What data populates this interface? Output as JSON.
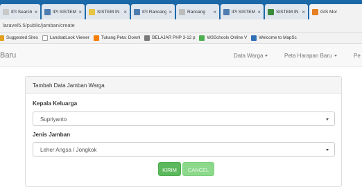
{
  "browser": {
    "tabs": [
      {
        "label": "IPI Search",
        "icon": "ipi-favicon",
        "color": "#c9c9c9"
      },
      {
        "label": "IPI SISTEM",
        "icon": "ipi-favicon",
        "color": "#4f7db0"
      },
      {
        "label": "SISTEM IN",
        "icon": "sistem-favicon",
        "color": "#e8c540"
      },
      {
        "label": "IPI Rancang",
        "icon": "ipi-favicon",
        "color": "#4f7db0"
      },
      {
        "label": "Rancang",
        "icon": "pdf-favicon",
        "color": "#bdbdbd"
      },
      {
        "label": "IPI SISTEM",
        "icon": "ipi-favicon",
        "color": "#4f7db0"
      },
      {
        "label": "SISTEM IN",
        "icon": "sistem-favicon",
        "color": "#3a8a3a"
      },
      {
        "label": "GIS Mor",
        "icon": "gis-favicon",
        "color": "#e67e22"
      }
    ],
    "url": "laravel5.5/public/jamban/create",
    "bookmarks": [
      {
        "label": "Suggested Sites",
        "icon": "apps-icon",
        "color": "#e0a020"
      },
      {
        "label": "LandsatLook Viewer",
        "icon": "page-icon",
        "color": "#9e9e9e"
      },
      {
        "label": "Tukang Peta: Downl",
        "icon": "blogger-icon",
        "color": "#f57d00"
      },
      {
        "label": "BELAJAR PHP 3-12 p",
        "icon": "php-icon",
        "color": "#7a7a7a"
      },
      {
        "label": "W3Schools Online V",
        "icon": "w3schools-icon",
        "color": "#4caf50"
      },
      {
        "label": "Welcome to MapSc",
        "icon": "mapsc-icon",
        "color": "#2e6fb5"
      }
    ]
  },
  "navbar": {
    "brand": "Baru",
    "links": [
      {
        "label": "Data Warga",
        "dropdown": true
      },
      {
        "label": "Peta Harapan Baru",
        "dropdown": true
      },
      {
        "label": "Pe",
        "dropdown": false
      }
    ]
  },
  "form": {
    "heading": "Tambah Data Jamban Warga",
    "kepala_label": "Kepala Keluarga",
    "kepala_value": "Supriyanto",
    "jenis_label": "Jenis Jamban",
    "jenis_value": "Leher Angsa / Jongkok",
    "submit_label": "KIRIM",
    "cancel_label": "CANCEL",
    "colors": {
      "primary": "#5cb85c",
      "cancel": "#8cd98c"
    }
  }
}
